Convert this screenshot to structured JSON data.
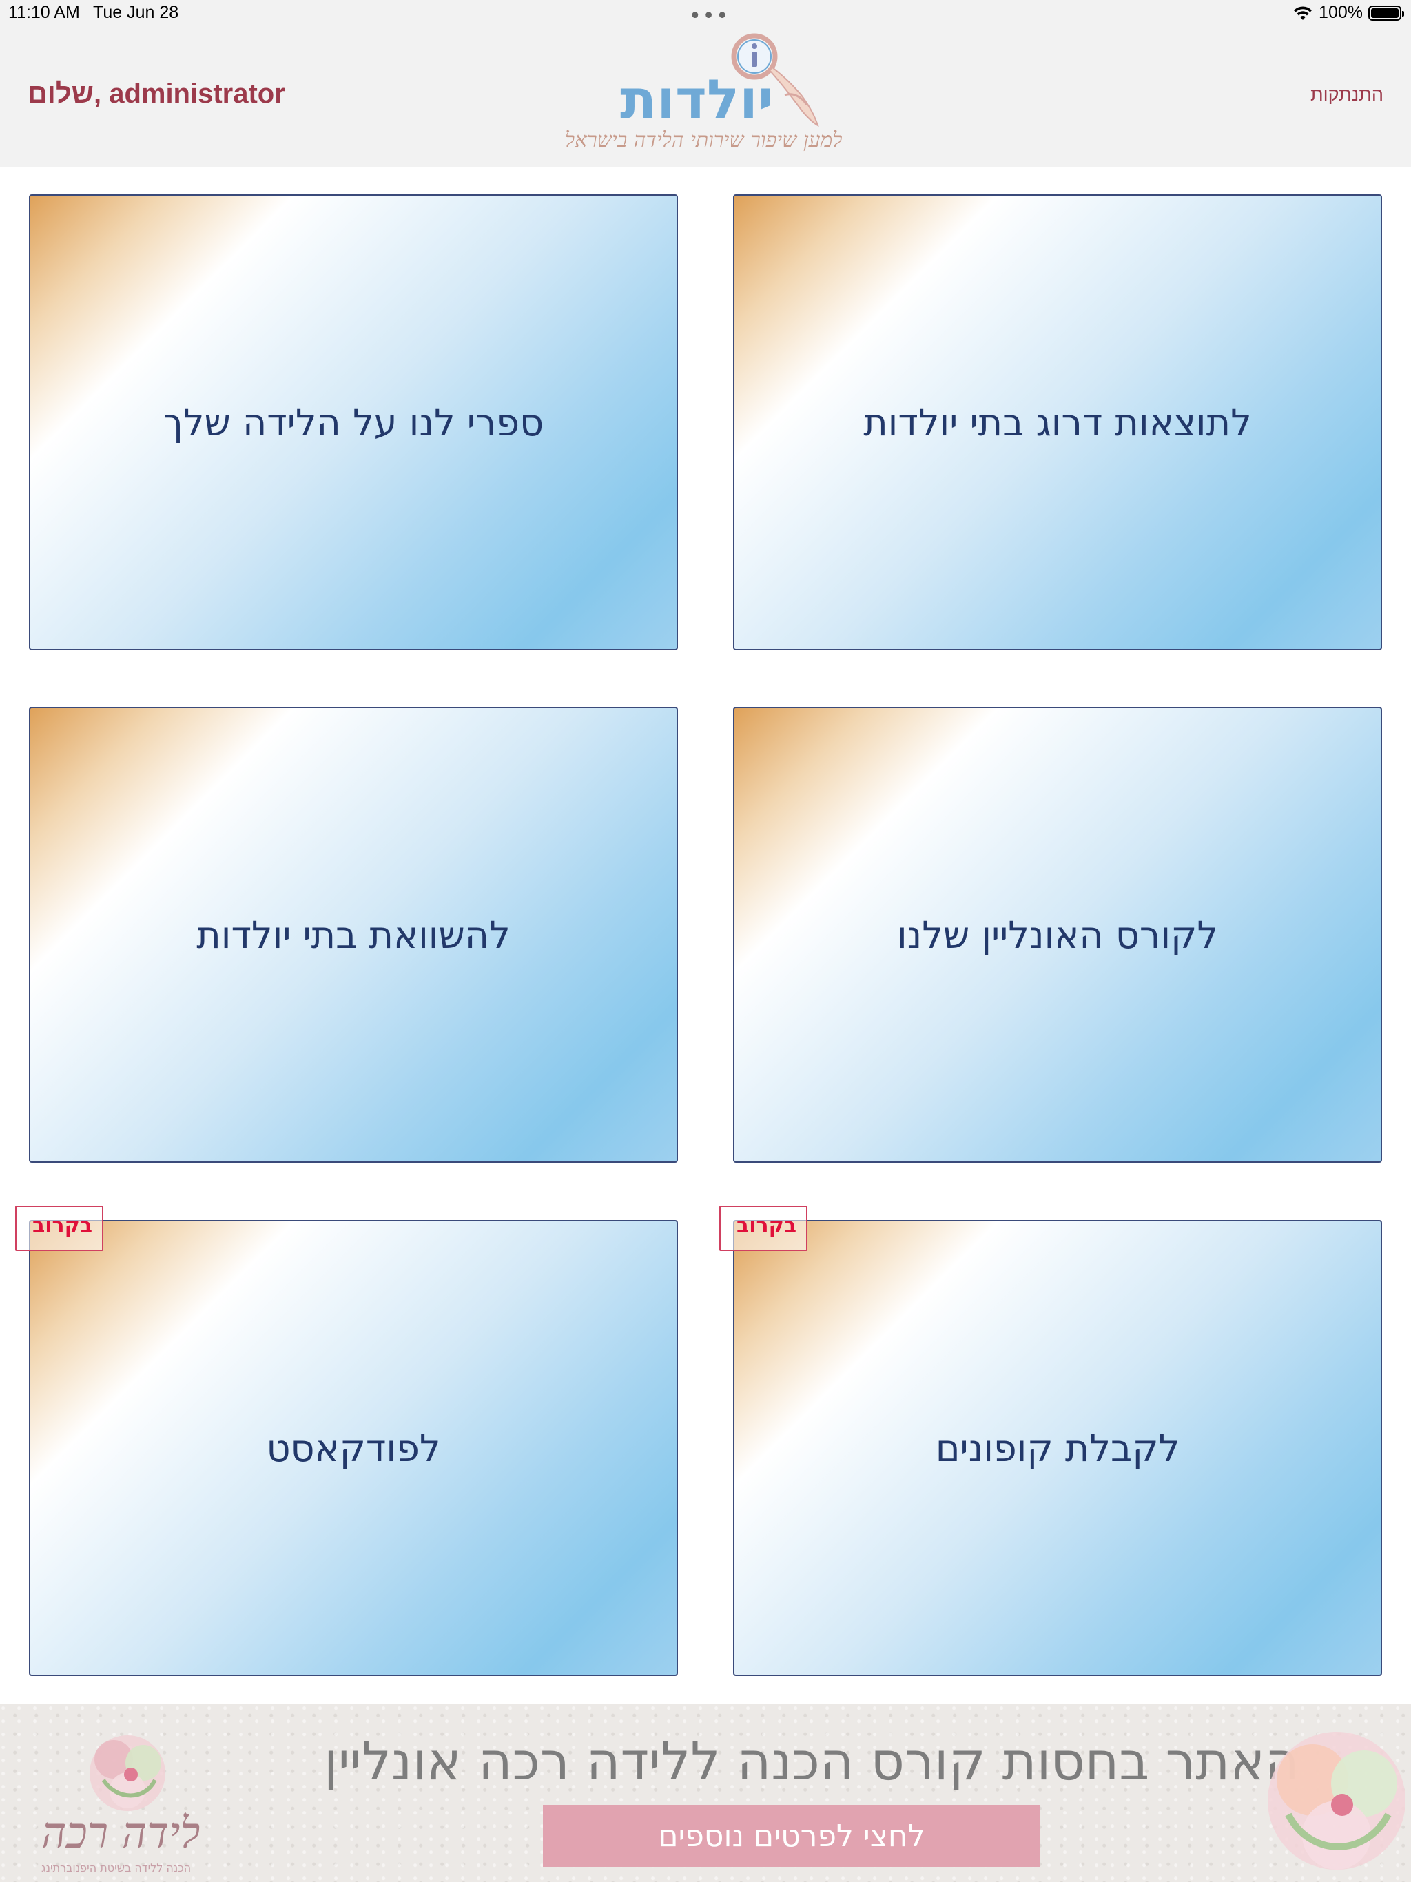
{
  "status_bar": {
    "time": "11:10 AM",
    "date": "Tue Jun 28",
    "dots": "•••",
    "battery": "100%"
  },
  "header": {
    "greeting": "שלום, administrator",
    "logout": "התנתקות",
    "logo_title": "יולדות",
    "logo_subtitle": "למען שיפור שירותי הלידה בישראל"
  },
  "tiles": [
    {
      "label": "לתוצאות דרוג בתי יולדות",
      "badge": ""
    },
    {
      "label": "ספרי לנו על הלידה שלך",
      "badge": ""
    },
    {
      "label": "לקורס האונליין שלנו",
      "badge": ""
    },
    {
      "label": "להשוואת בתי יולדות",
      "badge": ""
    },
    {
      "label": "לקבלת קופונים",
      "badge": "בקרוב"
    },
    {
      "label": "לפודקאסט",
      "badge": "בקרוב"
    }
  ],
  "banner": {
    "headline": "האתר בחסות קורס הכנה ללידה רכה אונליין",
    "button": "לחצי לפרטים נוספים",
    "brand": "לידה רכה",
    "brand_sub": "הכנה ללידה בשיטת היפנוברתינג"
  },
  "colors": {
    "accent": "#9c3a4b",
    "tile_text": "#22386a",
    "tile_border": "#3a4a7a",
    "badge": "#e0103a",
    "banner_button": "#e1a3b0"
  }
}
